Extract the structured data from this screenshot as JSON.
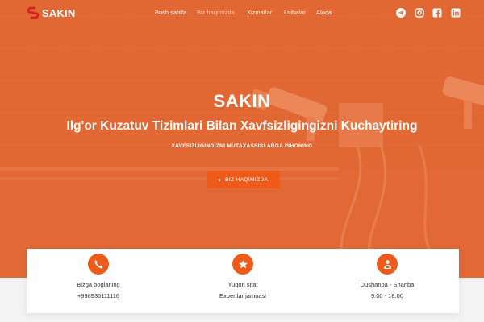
{
  "brand": {
    "name": "SAKIN",
    "accent": "#ee5a1a"
  },
  "nav": {
    "items": [
      {
        "label": "Bosh sahifa"
      },
      {
        "label": "Biz haqimizda"
      },
      {
        "label": "Xizmatlar"
      },
      {
        "label": "Loihalar"
      },
      {
        "label": "Aloqa"
      }
    ],
    "social": [
      "telegram-icon",
      "instagram-icon",
      "facebook-icon",
      "linkedin-icon"
    ]
  },
  "hero": {
    "title": "SAKIN",
    "subtitle": "Ilg'or Kuzatuv Tizimlari Bilan Xavfsizligingizni Kuchaytiring",
    "tagline": "XAVFSIZLIGINGIZNI MUTAXASSISLARGA ISHONING",
    "cta_label": "BIZ HAQIMIZDA"
  },
  "features": [
    {
      "icon": "phone-icon",
      "label": "Bizga boglaning",
      "value": "+998936111116"
    },
    {
      "icon": "star-icon",
      "label": "Yuqori sifat",
      "value": "Expertlar jamoasi"
    },
    {
      "icon": "team-icon",
      "label": "Dushanba - Shanba",
      "value": "9:00 - 18:00"
    }
  ]
}
